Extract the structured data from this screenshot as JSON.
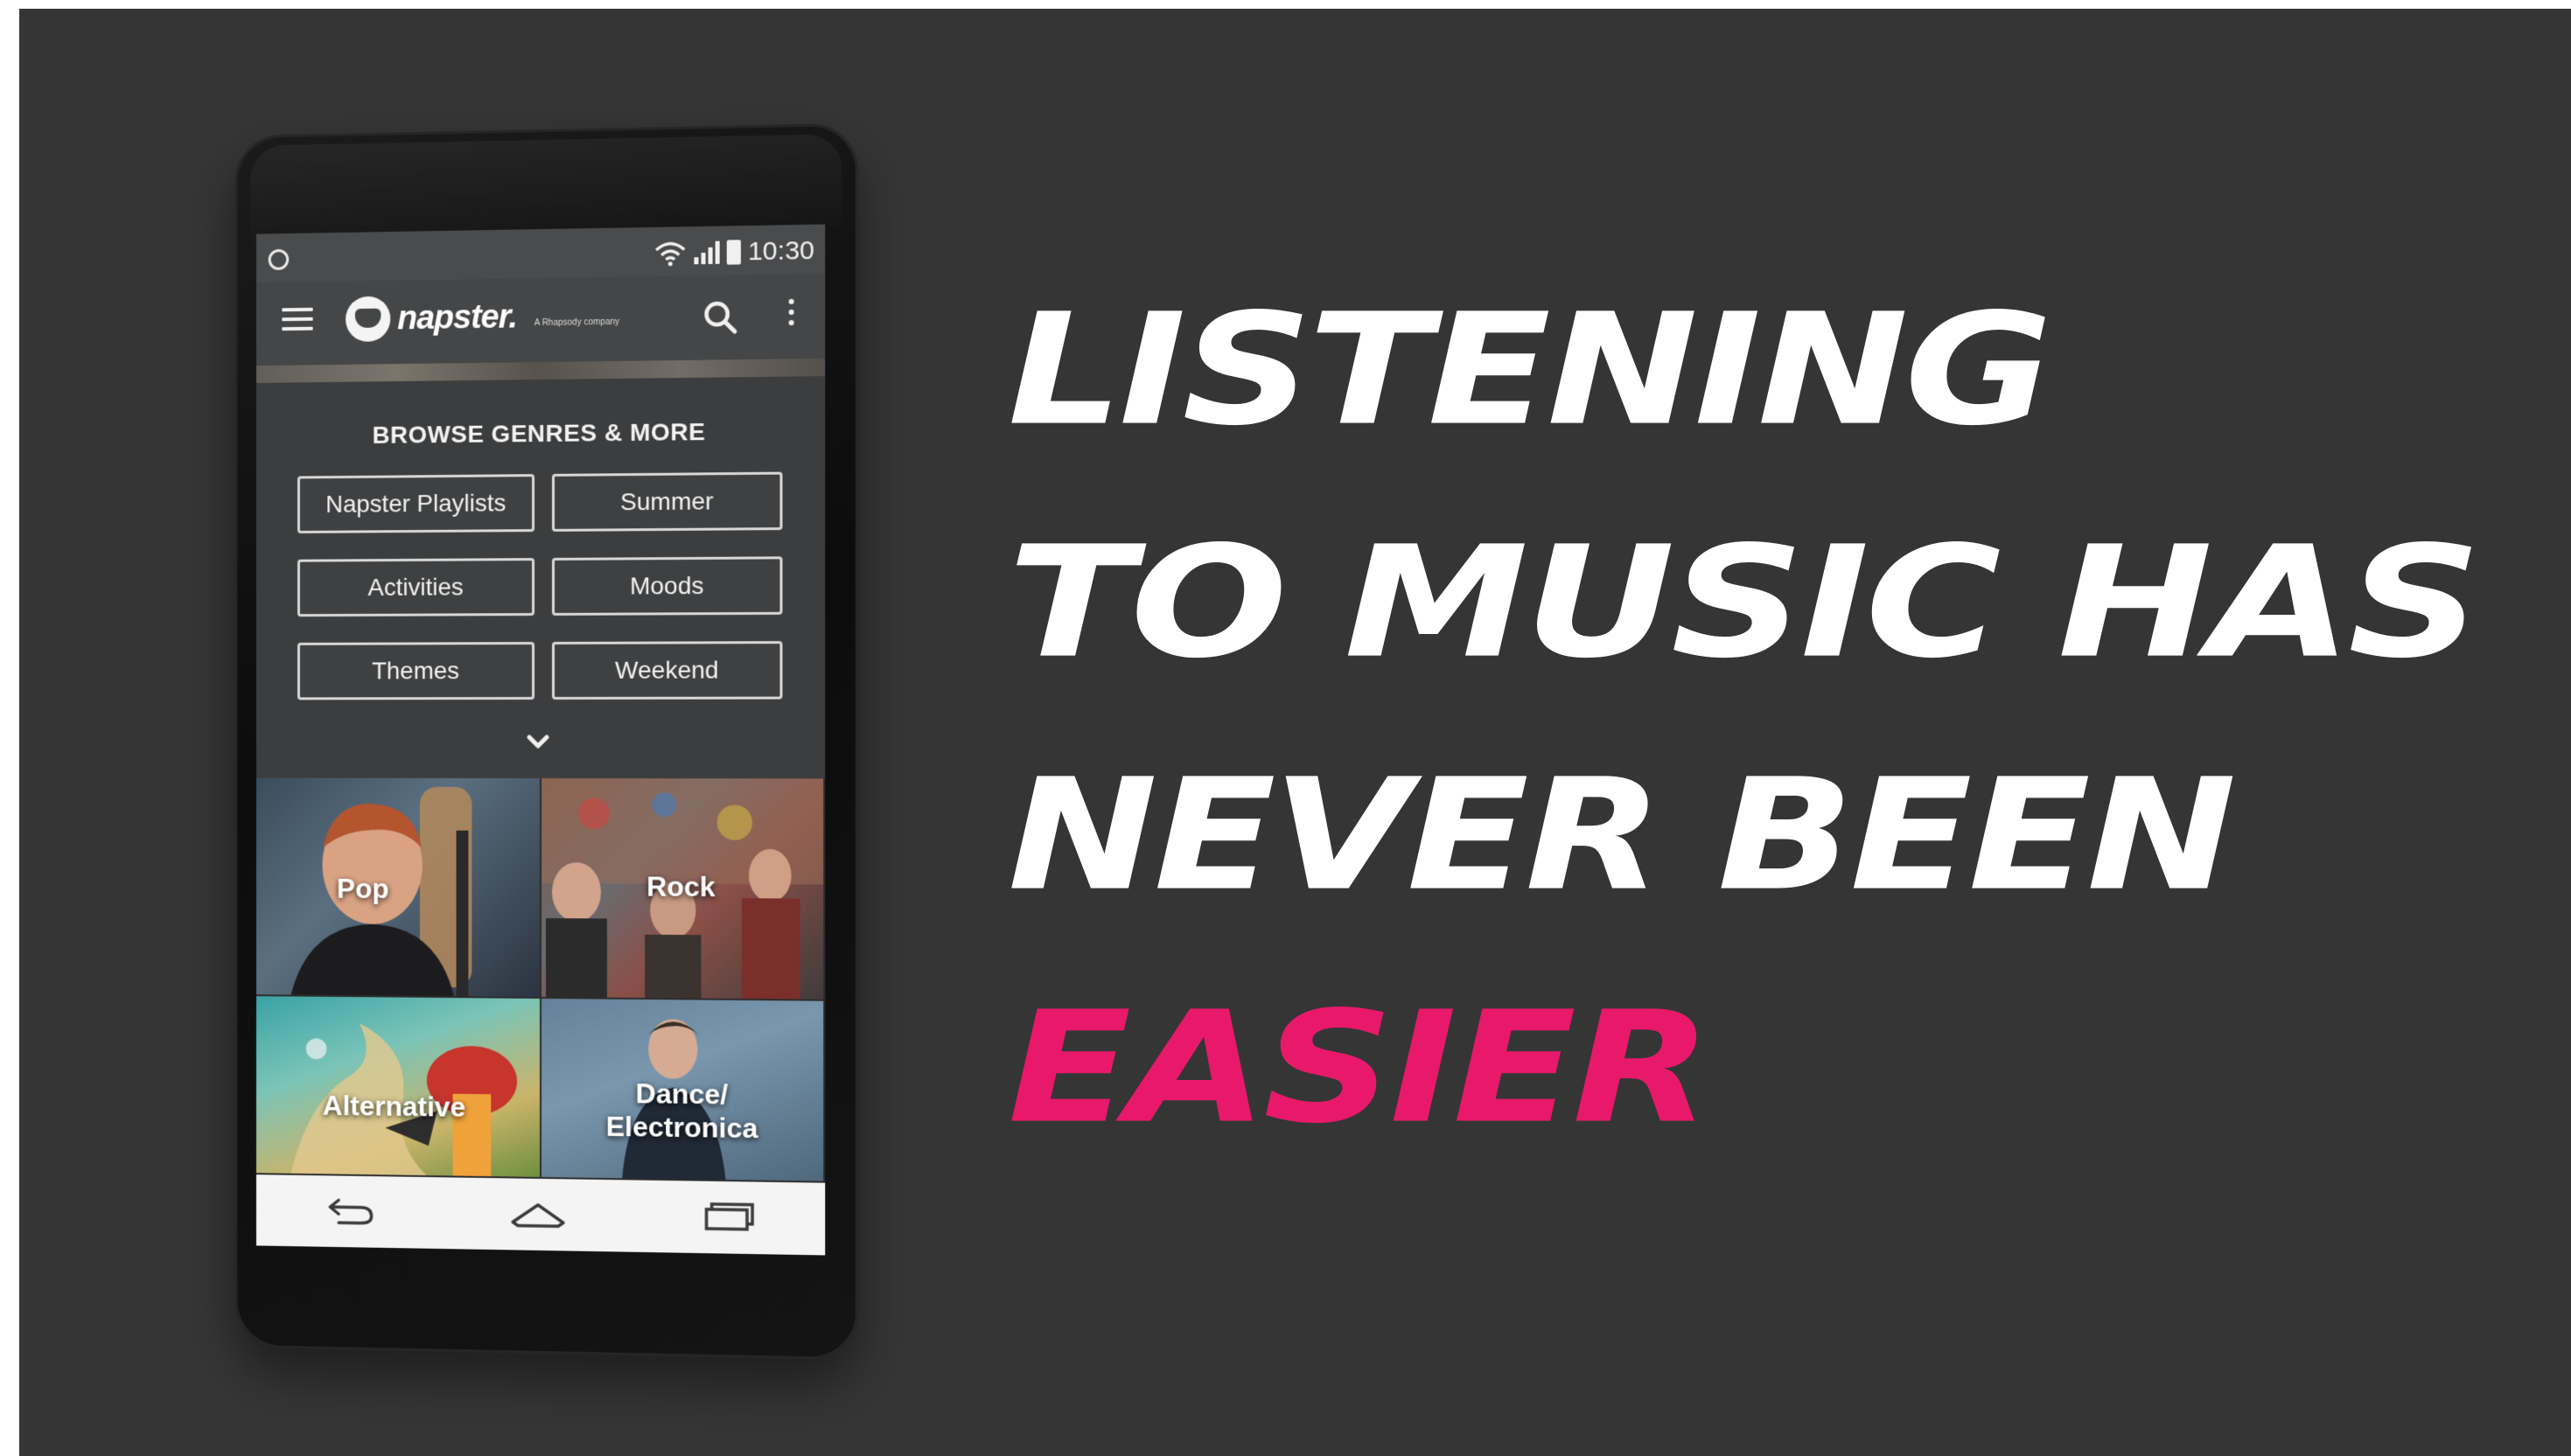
{
  "status_bar": {
    "time": "10:30"
  },
  "app_bar": {
    "logo_text": "napster.",
    "tagline": "A Rhapsody company"
  },
  "browse": {
    "heading": "BROWSE GENRES & MORE",
    "buttons": [
      "Napster Playlists",
      "Summer",
      "Activities",
      "Moods",
      "Themes",
      "Weekend"
    ]
  },
  "tiles": [
    {
      "label": "Pop"
    },
    {
      "label": "Rock"
    },
    {
      "label": "Alternative"
    },
    {
      "label": "Dance/ Electronica"
    }
  ],
  "headline": {
    "line1": "LISTENING",
    "line2": "TO MUSIC HAS",
    "line3": "NEVER BEEN",
    "line4": "EASIER"
  },
  "colors": {
    "background": "#353535",
    "headline_white": "#ffffff",
    "headline_accent": "#e8196a"
  },
  "icons": [
    "menu-icon",
    "napster-logo-icon",
    "search-icon",
    "more-options-icon",
    "chevron-down-icon",
    "back-icon",
    "home-icon",
    "recent-apps-icon",
    "wifi-icon",
    "signal-icon",
    "battery-icon"
  ]
}
